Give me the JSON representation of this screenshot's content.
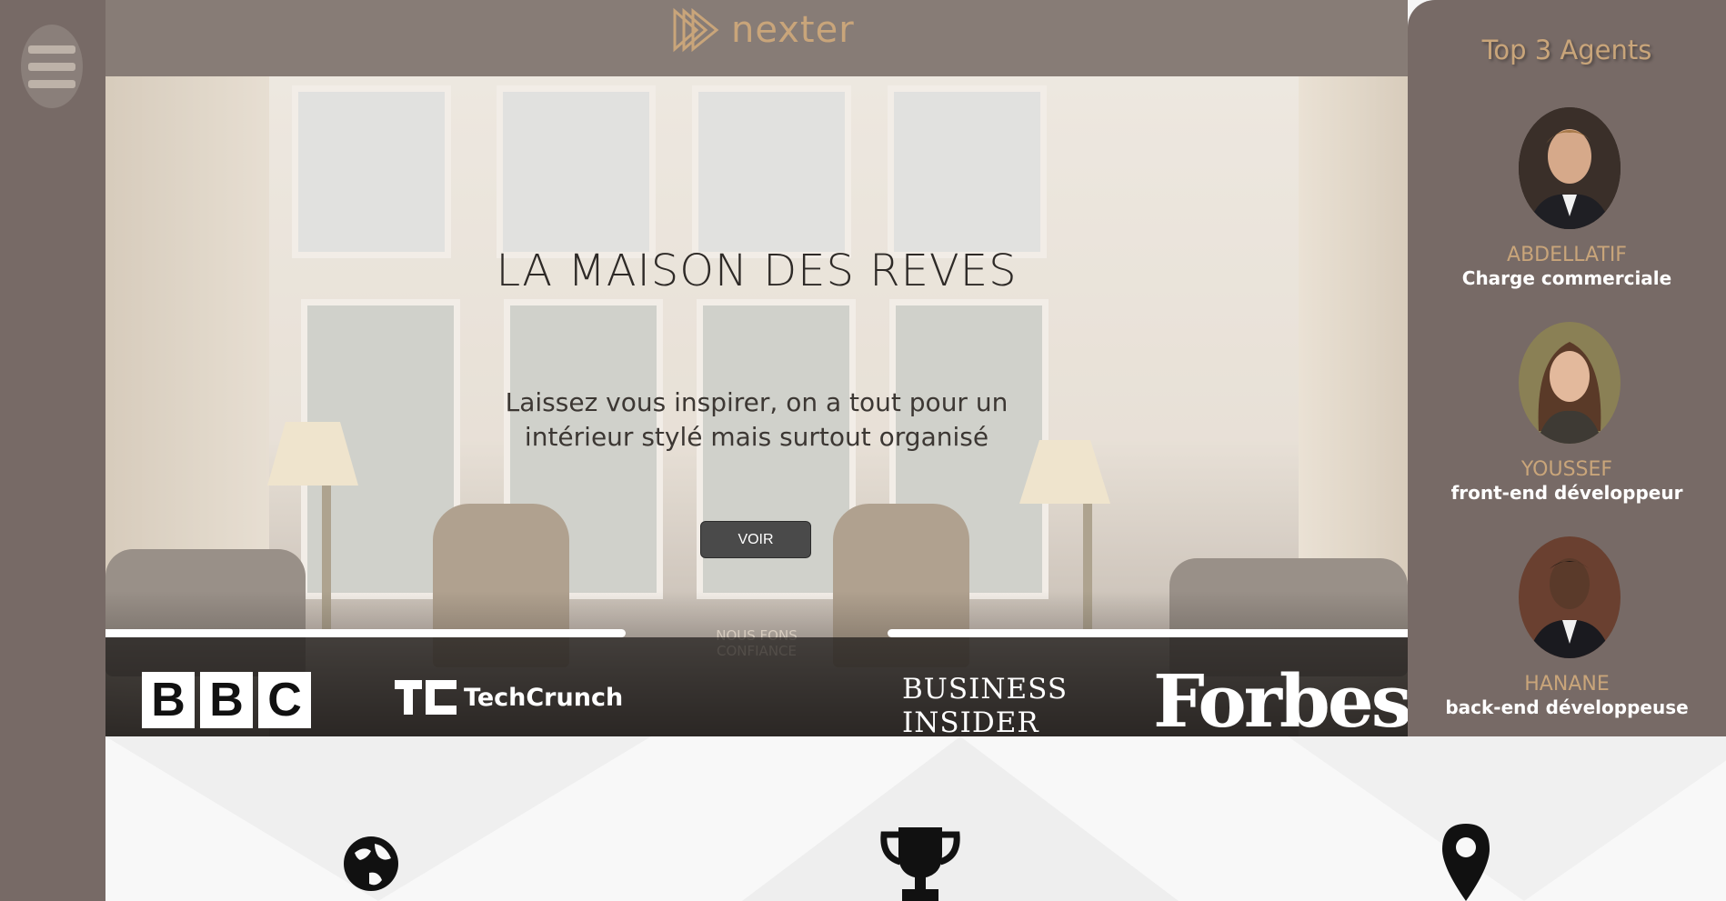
{
  "header": {
    "menu_icon": "hamburger-menu-icon",
    "logo_text": "nexter",
    "logo_icon": "triple-play-arrow-icon",
    "brand_color": "#c9a57a"
  },
  "hero": {
    "title": "LA MAISON DES REVES",
    "subtitle": "Laissez vous inspirer, on a tout pour un intérieur stylé mais surtout organisé",
    "cta_label": "VOIR"
  },
  "trust": {
    "label": "NOUS FONS CONFIANCE",
    "logos": [
      "BBC",
      "TechCrunch",
      "BUSINESS INSIDER",
      "Forbes"
    ],
    "bbc_letters": [
      "B",
      "B",
      "C"
    ],
    "techcrunch_name": "TechCrunch",
    "business_insider_lines": [
      "BUSINESS",
      "INSIDER"
    ],
    "forbes": "Forbes"
  },
  "agents_panel": {
    "title": "Top 3 Agents",
    "agents": [
      {
        "name": "ABDELLATIF",
        "role": "Charge commerciale"
      },
      {
        "name": "YOUSSEF",
        "role": "front-end développeur"
      },
      {
        "name": "HANANE",
        "role": "back-end développeuse"
      }
    ]
  },
  "features": {
    "icons": [
      "globe-icon",
      "trophy-icon",
      "map-pin-icon"
    ]
  },
  "colors": {
    "sidebar": "#776a66",
    "topbar": "#877c76",
    "accent": "#c9a57a",
    "button": "#4a4a4a"
  }
}
